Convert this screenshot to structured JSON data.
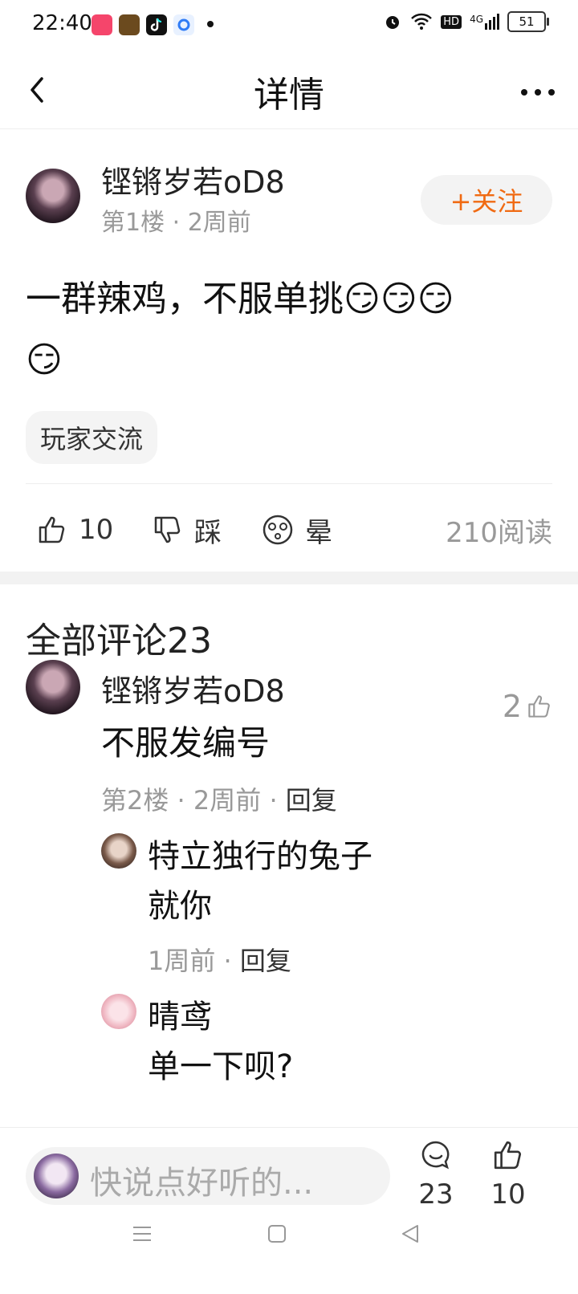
{
  "status_bar": {
    "time": "22:40",
    "network": "4G",
    "hd": "HD",
    "battery": "51",
    "app_icons": [
      "kuaishou-icon",
      "game-icon",
      "tiktok-icon",
      "browser-icon"
    ],
    "alarm_icon": "alarm-icon",
    "wifi_icon": "wifi-icon",
    "signal_icon": "signal-icon"
  },
  "header": {
    "title": "详情"
  },
  "post": {
    "author": "铿锵岁若oD8",
    "floor": "第1楼",
    "time": "2周前",
    "follow_label": "+关注",
    "text_line1": "一群辣鸡，不服单挑😏😏😏",
    "text_line2": "😏",
    "tag": "玩家交流",
    "likes": "10",
    "dislike_label": "踩",
    "dizzy_label": "晕",
    "reads": "210阅读"
  },
  "comments_section": {
    "title": "全部评论23"
  },
  "comment": {
    "author": "铿锵岁若oD8",
    "likes": "2",
    "text": "不服发编号",
    "floor": "第2楼",
    "time": "2周前",
    "reply_label": "回复",
    "replies": [
      {
        "author": "特立独行的兔子",
        "text": "就你",
        "time": "1周前",
        "reply_label": "回复"
      },
      {
        "author": "晴鸢",
        "text": "单一下呗?"
      }
    ]
  },
  "bottom_bar": {
    "input_placeholder": "快说点好听的...",
    "comment_count": "23",
    "like_count": "10"
  },
  "colors": {
    "accent": "#f06a12",
    "muted": "#999999",
    "separator": "#f2f2f2"
  }
}
